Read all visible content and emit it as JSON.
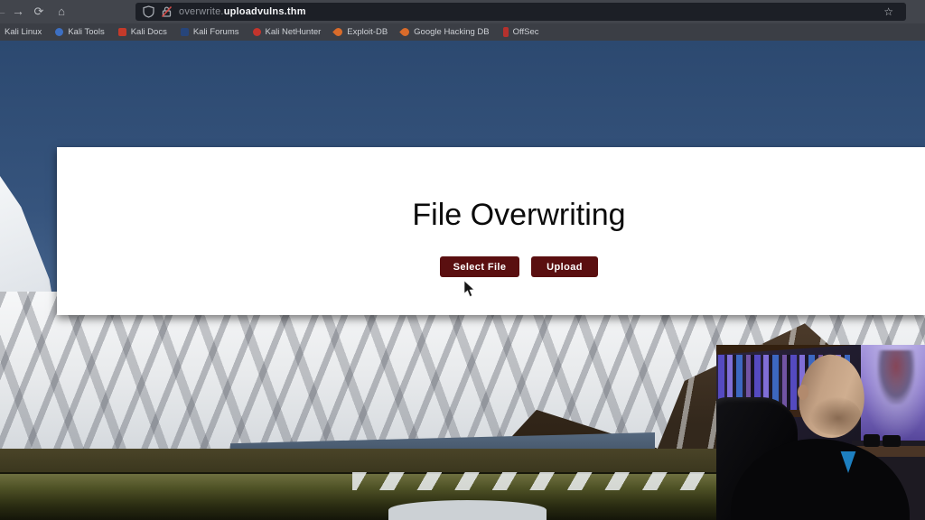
{
  "browser": {
    "nav_icons": {
      "back": "←",
      "forward": "→",
      "reload": "⟳",
      "home": "⌂",
      "star": "☆"
    },
    "urlbar": {
      "subdomain": "overwrite.",
      "domain": "uploadvulns.thm"
    },
    "bookmarks": [
      {
        "label": "Kali Linux",
        "icon_color": null
      },
      {
        "label": "Kali Tools",
        "icon_color": "#3d6fc2"
      },
      {
        "label": "Kali Docs",
        "icon_color": "#c43a2a"
      },
      {
        "label": "Kali Forums",
        "icon_color": "#27457a"
      },
      {
        "label": "Kali NetHunter",
        "icon_color": "#c3342c"
      },
      {
        "label": "Exploit-DB",
        "icon_color": "#d96b2a"
      },
      {
        "label": "Google Hacking DB",
        "icon_color": "#d96b2a"
      },
      {
        "label": "OffSec",
        "icon_color": "#b5312d"
      }
    ]
  },
  "page": {
    "title": "File Overwriting",
    "select_file_label": "Select File",
    "upload_label": "Upload",
    "button_color": "#5a0f10"
  }
}
